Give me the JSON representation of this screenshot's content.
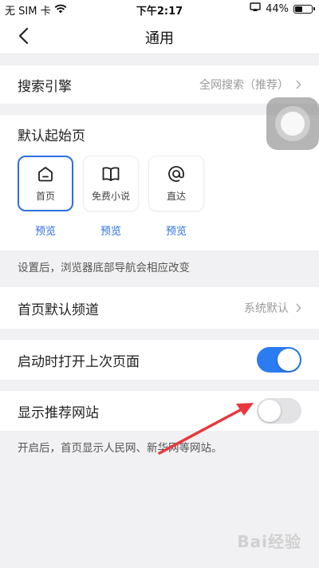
{
  "status_bar": {
    "carrier": "无 SIM 卡",
    "time": "下午2:17",
    "battery": "44%",
    "battery_level": 0.44
  },
  "nav": {
    "title": "通用"
  },
  "search_engine": {
    "label": "搜索引擎",
    "value": "全网搜索（推荐）"
  },
  "start_page": {
    "title": "默认起始页",
    "options": [
      {
        "label": "首页",
        "preview": "预览",
        "icon": "home-icon",
        "selected": true
      },
      {
        "label": "免费小说",
        "preview": "预览",
        "icon": "book-icon",
        "selected": false
      },
      {
        "label": "直达",
        "preview": "预览",
        "icon": "at-icon",
        "selected": false
      }
    ],
    "hint": "设置后，浏览器底部导航会相应改变"
  },
  "home_channel": {
    "label": "首页默认频道",
    "value": "系统默认"
  },
  "restore_last_page": {
    "label": "启动时打开上次页面",
    "enabled": true
  },
  "show_recommended": {
    "label": "显示推荐网站",
    "enabled": false,
    "hint": "开启后，首页显示人民网、新华网等网站。"
  },
  "colors": {
    "accent": "#2b7cf0",
    "selected_border": "#2d6fe5",
    "toggle_off": "#e3e3e6",
    "annotation_arrow": "#e8383d"
  },
  "watermark": "Bai经验"
}
